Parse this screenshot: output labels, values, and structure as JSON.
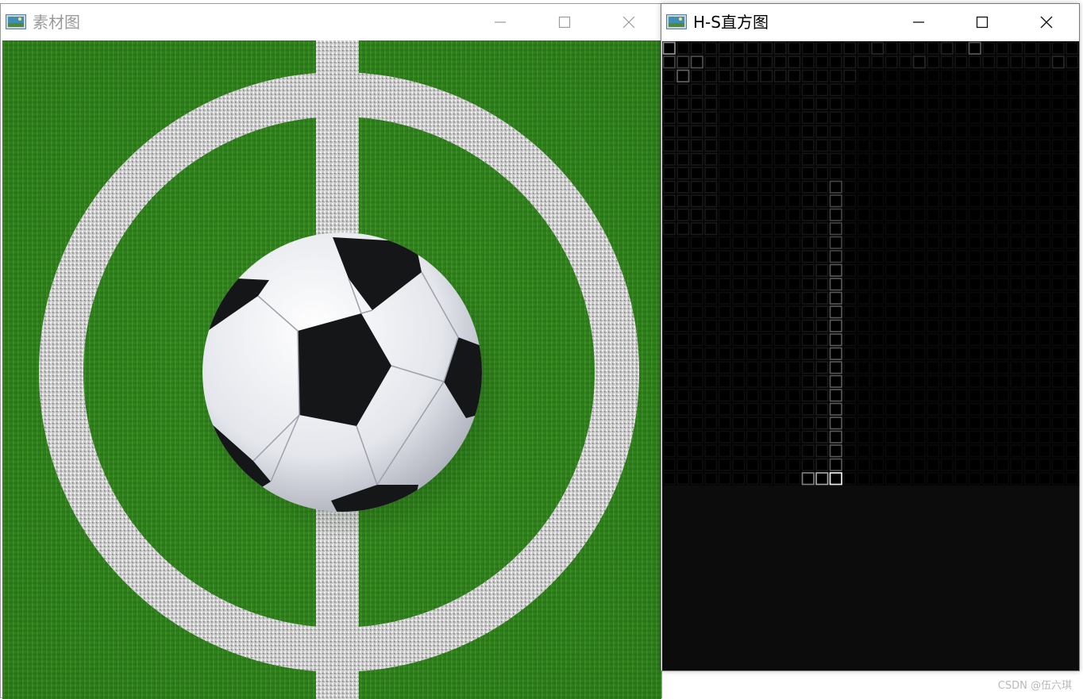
{
  "left_window": {
    "title": "素材图",
    "icon": "opencv-window-icon",
    "buttons": [
      "minimize",
      "maximize",
      "close"
    ],
    "image_subject": "soccer ball on center circle of grass field"
  },
  "right_window": {
    "title": "H-S直方图",
    "icon": "opencv-window-icon",
    "buttons": [
      "minimize",
      "maximize",
      "close"
    ]
  },
  "watermark": "CSDN @伍六琪",
  "colors": {
    "grass": "#2f7d1c",
    "histogram_bg": "#000000",
    "window_bg": "#0c0c0c"
  }
}
